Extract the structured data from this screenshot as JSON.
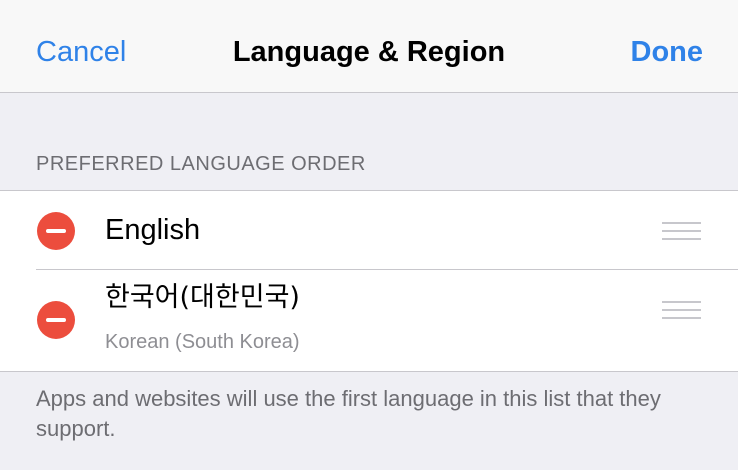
{
  "navbar": {
    "cancel_label": "Cancel",
    "title": "Language & Region",
    "done_label": "Done"
  },
  "section": {
    "header": "PREFERRED LANGUAGE ORDER"
  },
  "languages": [
    {
      "name": "English",
      "subtitle": ""
    },
    {
      "name": "한국어(대한민국)",
      "subtitle": "Korean (South Korea)"
    }
  ],
  "footer": {
    "note": "Apps and websites will use the first language in this list that they support."
  },
  "colors": {
    "accent": "#2f82e8",
    "delete": "#ec4d3d",
    "background": "#efeff4"
  }
}
